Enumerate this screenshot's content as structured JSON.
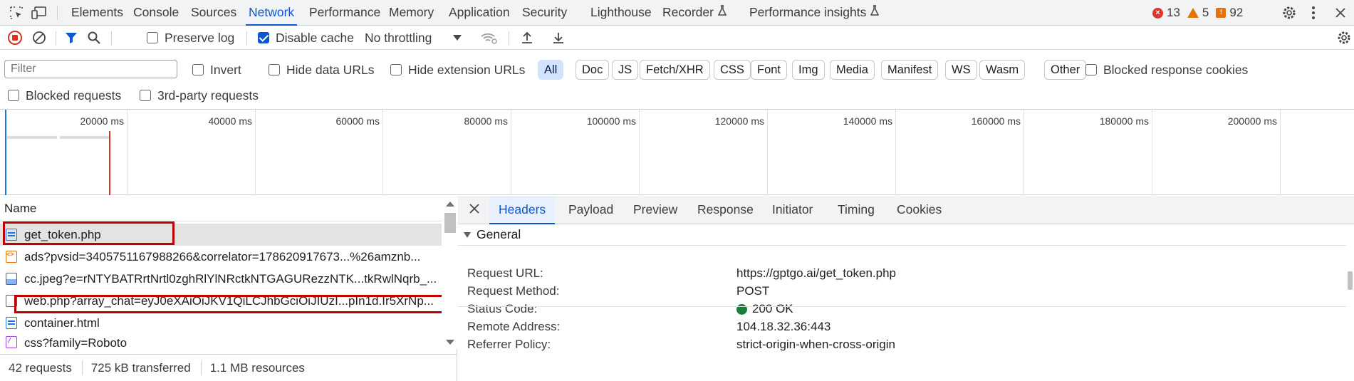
{
  "topbar": {
    "tabs": [
      "Elements",
      "Console",
      "Sources",
      "Network",
      "Performance",
      "Memory",
      "Application",
      "Security",
      "Lighthouse",
      "Recorder",
      "Performance insights"
    ],
    "active_tab": "Network",
    "error_count": "13",
    "warning_count": "5",
    "issue_count": "92"
  },
  "toolbar": {
    "preserve_log": "Preserve log",
    "disable_cache": "Disable cache",
    "throttling": "No throttling"
  },
  "filters": {
    "placeholder": "Filter",
    "invert": "Invert",
    "hide_data_urls": "Hide data URLs",
    "hide_extension_urls": "Hide extension URLs",
    "types": [
      "All",
      "Doc",
      "JS",
      "Fetch/XHR",
      "CSS",
      "Font",
      "Img",
      "Media",
      "Manifest",
      "WS",
      "Wasm",
      "Other"
    ],
    "blocked_response_cookies": "Blocked response cookies",
    "blocked_requests": "Blocked requests",
    "third_party_requests": "3rd-party requests"
  },
  "overview": {
    "ticks": [
      "20000 ms",
      "40000 ms",
      "60000 ms",
      "80000 ms",
      "100000 ms",
      "120000 ms",
      "140000 ms",
      "160000 ms",
      "180000 ms",
      "200000 ms"
    ]
  },
  "requests": {
    "header": "Name",
    "rows": [
      {
        "name": "get_token.php",
        "icon": "document-icon"
      },
      {
        "name": "ads?pvsid=3405751167988266&correlator=178620917673...%26amznb...",
        "icon": "script-icon"
      },
      {
        "name": "cc.jpeg?e=rNTYBATRrtNrtl0zghRlYlNRctkNTGAGURezzNTK...tkRwlNqrb_...",
        "icon": "image-icon"
      },
      {
        "name": "web.php?array_chat=eyJ0eXAiOiJKV1QiLCJhbGciOiJIUzI...pIn1d.Ir5XrNp...",
        "icon": "blank-file-icon"
      },
      {
        "name": "container.html",
        "icon": "document-icon"
      },
      {
        "name": "css?family=Roboto",
        "icon": "stylesheet-icon"
      }
    ],
    "status": {
      "requests": "42 requests",
      "transferred": "725 kB transferred",
      "resources": "1.1 MB resources"
    }
  },
  "details": {
    "tabs": [
      "Headers",
      "Payload",
      "Preview",
      "Response",
      "Initiator",
      "Timing",
      "Cookies"
    ],
    "active_tab": "Headers",
    "section": "General",
    "fields": [
      {
        "key": "Request URL:",
        "value": "https://gptgo.ai/get_token.php"
      },
      {
        "key": "Request Method:",
        "value": "POST"
      },
      {
        "key": "Status Code:",
        "value": "200 OK"
      },
      {
        "key": "Remote Address:",
        "value": "104.18.32.36:443"
      },
      {
        "key": "Referrer Policy:",
        "value": "strict-origin-when-cross-origin"
      }
    ]
  },
  "colors": {
    "accent": "#0b57d0",
    "error": "#dc362e",
    "warning": "#e37400",
    "status_ok": "#188038",
    "highlight_box": "#c00000"
  }
}
